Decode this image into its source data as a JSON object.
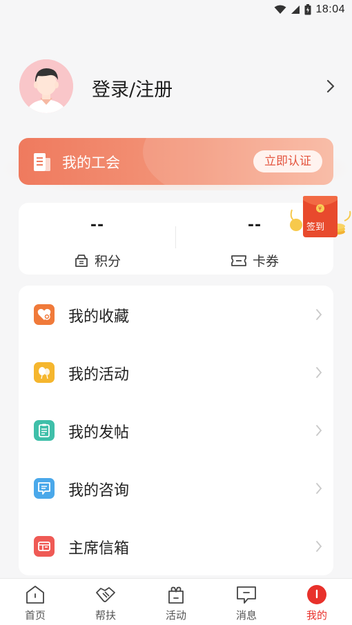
{
  "status_bar": {
    "time": "18:04"
  },
  "profile": {
    "login_text": "登录/注册"
  },
  "union": {
    "title": "我的工会",
    "certify_button": "立即认证"
  },
  "stats": {
    "points": {
      "value": "--",
      "label": "积分"
    },
    "coupons": {
      "value": "--",
      "label": "卡券"
    },
    "signin_label": "签到"
  },
  "menu": {
    "items": [
      {
        "label": "我的收藏",
        "icon": "heart-icon",
        "color": "#f07a3a"
      },
      {
        "label": "我的活动",
        "icon": "balloon-icon",
        "color": "#f5b62e"
      },
      {
        "label": "我的发帖",
        "icon": "clipboard-icon",
        "color": "#3fbfa9"
      },
      {
        "label": "我的咨询",
        "icon": "chat-icon",
        "color": "#4aa8ea"
      },
      {
        "label": "主席信箱",
        "icon": "mailbox-icon",
        "color": "#ef5a55"
      }
    ]
  },
  "tabbar": {
    "tabs": [
      {
        "label": "首页",
        "icon": "home-icon"
      },
      {
        "label": "帮扶",
        "icon": "handshake-icon"
      },
      {
        "label": "活动",
        "icon": "gift-icon"
      },
      {
        "label": "消息",
        "icon": "message-icon"
      },
      {
        "label": "我的",
        "icon": "profile-icon",
        "active": true
      }
    ]
  },
  "colors": {
    "accent": "#e8312b",
    "banner": "#ef7a5e"
  }
}
